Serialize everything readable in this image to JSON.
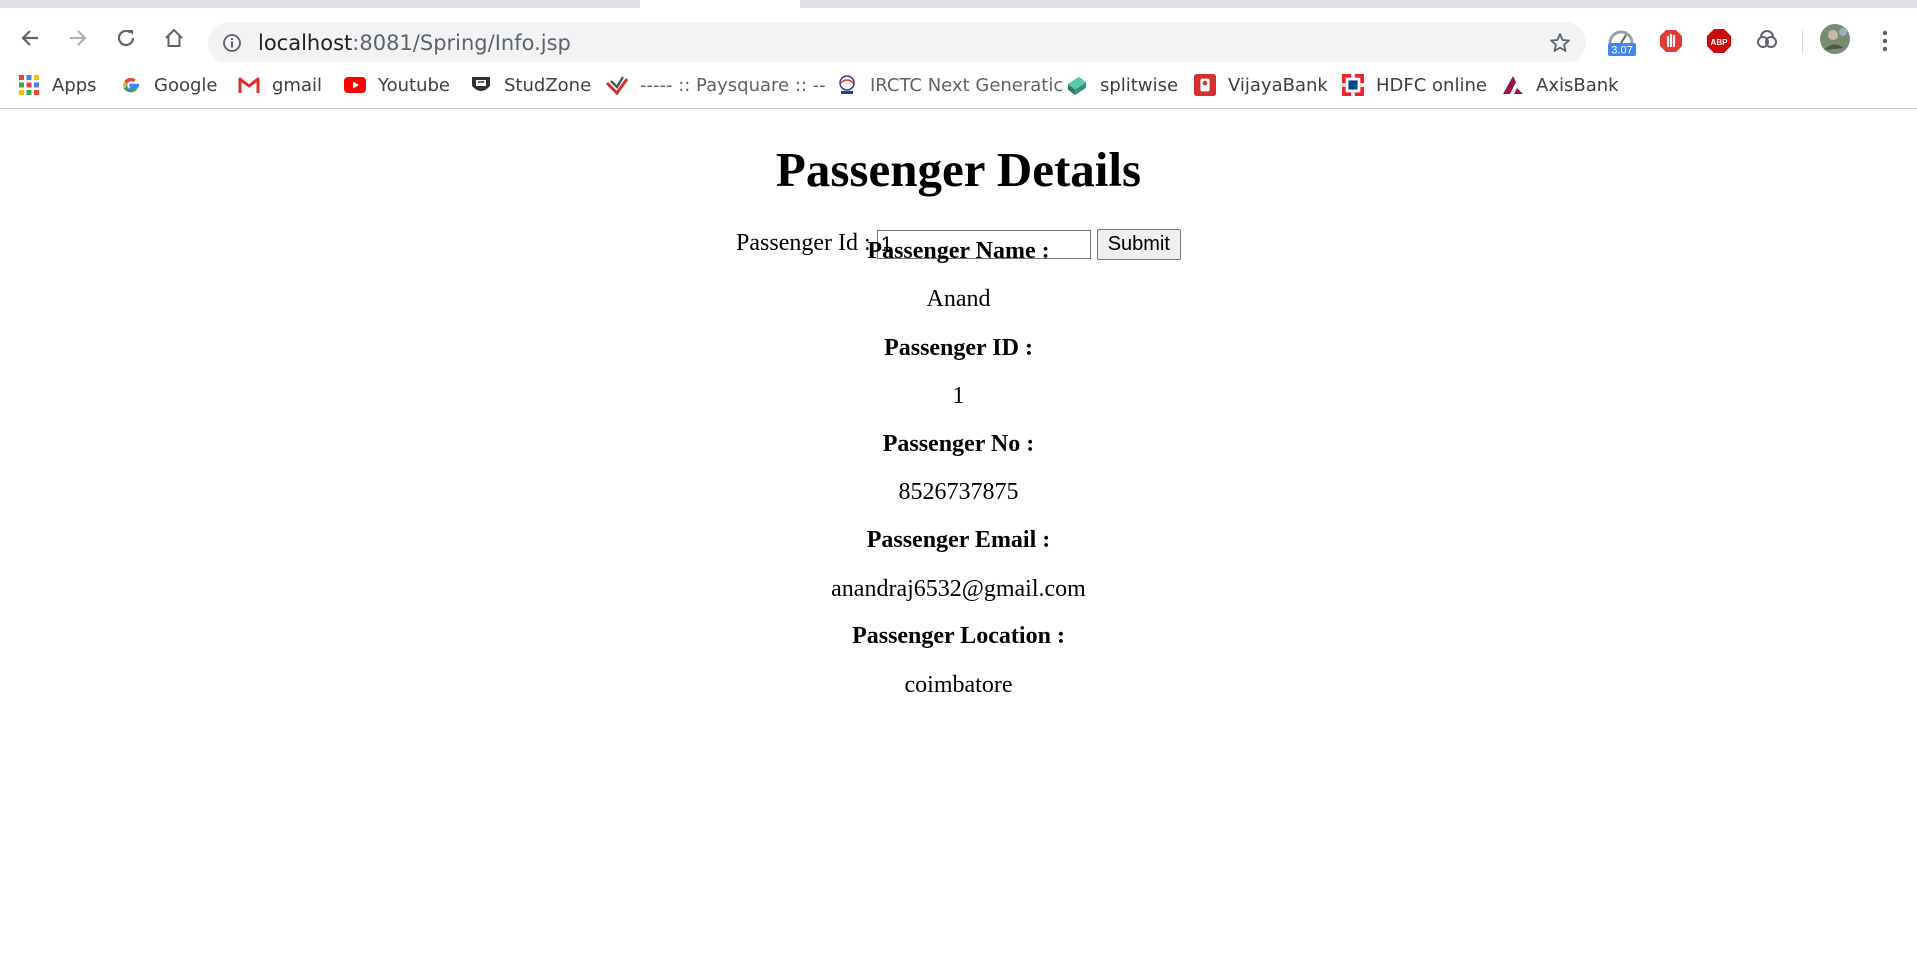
{
  "browser": {
    "url_host": "localhost",
    "url_path": ":8081/Spring/Info.jsp",
    "extension_badge": "3.07",
    "abp_label": "ABP"
  },
  "bookmarks": [
    {
      "label": "Apps",
      "icon": "apps-grid-icon"
    },
    {
      "label": "Google",
      "icon": "google-icon"
    },
    {
      "label": "gmail",
      "icon": "gmail-icon"
    },
    {
      "label": "Youtube",
      "icon": "youtube-icon"
    },
    {
      "label": "StudZone",
      "icon": "studzone-icon"
    },
    {
      "label": "----- :: Paysquare :: --",
      "icon": "paysquare-icon"
    },
    {
      "label": "IRCTC Next Generatic",
      "icon": "irctc-icon"
    },
    {
      "label": "splitwise",
      "icon": "splitwise-icon"
    },
    {
      "label": "VijayaBank",
      "icon": "vijayabank-icon"
    },
    {
      "label": "HDFC online",
      "icon": "hdfc-icon"
    },
    {
      "label": "AxisBank",
      "icon": "axisbank-icon"
    }
  ],
  "page": {
    "title": "Passenger Details",
    "form": {
      "label": "Passenger Id :",
      "value": "1",
      "submit": "Submit"
    },
    "fields": [
      {
        "label": "Passenger Name :",
        "value": "Anand"
      },
      {
        "label": "Passenger ID :",
        "value": "1"
      },
      {
        "label": "Passenger No :",
        "value": "8526737875"
      },
      {
        "label": "Passenger Email :",
        "value": "anandraj6532@gmail.com"
      },
      {
        "label": "Passenger Location :",
        "value": "coimbatore"
      }
    ]
  }
}
